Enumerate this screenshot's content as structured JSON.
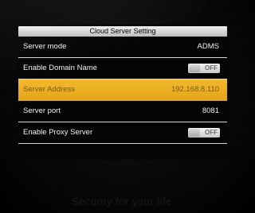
{
  "title": "Cloud Server Setting",
  "rows": [
    {
      "label": "Server mode",
      "value": "ADMS"
    },
    {
      "label": "Enable Domain Name",
      "toggle": "OFF"
    },
    {
      "label": "Server Address",
      "value": "192.168.8.110"
    },
    {
      "label": "Server port",
      "value": "8081"
    },
    {
      "label": "Enable Proxy Server",
      "toggle": "OFF"
    }
  ],
  "device_slogan": "Security for your life",
  "colors": {
    "highlight": "#e9ad20",
    "background": "#050505",
    "title_bar": "#d9d9d9"
  }
}
